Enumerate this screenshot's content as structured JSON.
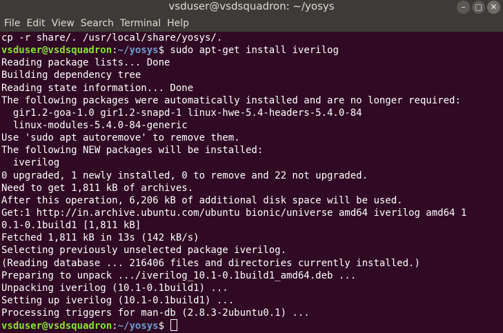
{
  "window": {
    "title": "vsduser@vsdsquadron: ~/yosys",
    "minimize_icon": "minimize-icon",
    "maximize_icon": "maximize-icon",
    "close_icon": "close-icon"
  },
  "menu": [
    "File",
    "Edit",
    "View",
    "Search",
    "Terminal",
    "Help"
  ],
  "terminal": {
    "colors": {
      "background": "#300a24",
      "user": "#8ae234",
      "path": "#729fcf",
      "text": "#ffffff"
    },
    "line_0": "cp -r share/. /usr/local/share/yosys/.",
    "prompt1": {
      "user": "vsduser@vsdsquadron",
      "sep": ":",
      "path": "~/yosys",
      "end": "$ ",
      "cmd": "sudo apt-get install iverilog"
    },
    "output": [
      "Reading package lists... Done",
      "Building dependency tree",
      "Reading state information... Done",
      "The following packages were automatically installed and are no longer required:",
      "  gir1.2-goa-1.0 gir1.2-snapd-1 linux-hwe-5.4-headers-5.4.0-84",
      "  linux-modules-5.4.0-84-generic",
      "Use 'sudo apt autoremove' to remove them.",
      "The following NEW packages will be installed:",
      "  iverilog",
      "0 upgraded, 1 newly installed, 0 to remove and 22 not upgraded.",
      "Need to get 1,811 kB of archives.",
      "After this operation, 6,206 kB of additional disk space will be used.",
      "Get:1 http://in.archive.ubuntu.com/ubuntu bionic/universe amd64 iverilog amd64 1",
      "0.1-0.1build1 [1,811 kB]",
      "Fetched 1,811 kB in 13s (142 kB/s)",
      "Selecting previously unselected package iverilog.",
      "(Reading database ... 216406 files and directories currently installed.)",
      "Preparing to unpack .../iverilog_10.1-0.1build1_amd64.deb ...",
      "Unpacking iverilog (10.1-0.1build1) ...",
      "Setting up iverilog (10.1-0.1build1) ...",
      "Processing triggers for man-db (2.8.3-2ubuntu0.1) ..."
    ],
    "prompt2": {
      "user": "vsduser@vsdsquadron",
      "sep": ":",
      "path": "~/yosys",
      "end": "$ "
    }
  }
}
